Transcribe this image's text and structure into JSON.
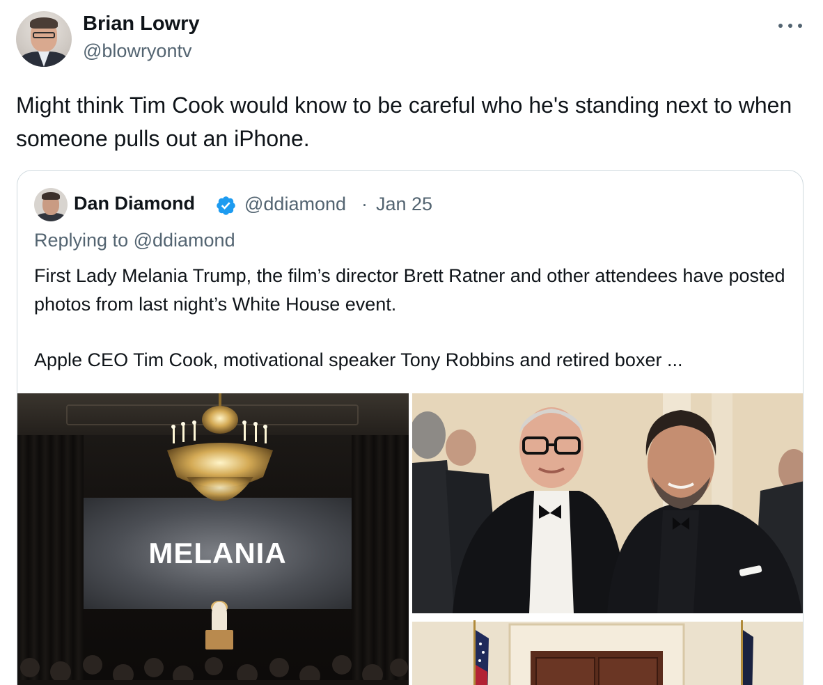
{
  "tweet": {
    "author_name": "Brian Lowry",
    "author_handle": "@blowryontv",
    "more_icon": "more-horizontal-icon",
    "text": "Might think Tim Cook would know to be careful who he's standing next to when someone pulls out an iPhone."
  },
  "quote": {
    "author_name": "Dan Diamond",
    "verified_icon": "verified-badge-icon",
    "verified_color": "#1d9bf0",
    "author_handle": "@ddiamond",
    "separator": "·",
    "date": "Jan 25",
    "replying_prefix": "Replying to ",
    "replying_handle": "@ddiamond",
    "text_paragraph_1": "First Lady Melania Trump, the film’s director Brett Ratner and other attendees have posted photos from last night’s White House event.",
    "text_paragraph_2": "Apple CEO Tim Cook, motivational speaker Tony Robbins and retired boxer ...",
    "media": {
      "screen_text": "MELANIA"
    }
  },
  "colors": {
    "text_primary": "#0f1419",
    "text_secondary": "#536471",
    "border": "#cfd9de"
  }
}
